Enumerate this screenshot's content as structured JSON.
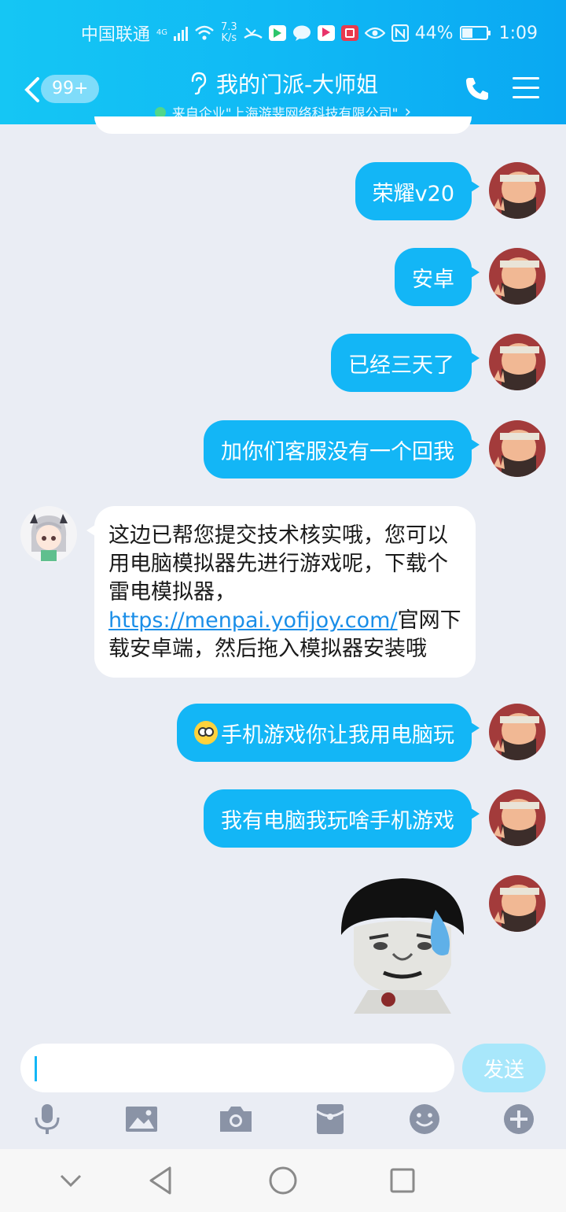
{
  "status_bar": {
    "carrier": "中国联通",
    "network": "4G",
    "speed_value": "7.3",
    "speed_unit": "K/s",
    "battery_percent": "44%",
    "battery_level": 0.44,
    "time": "1:09"
  },
  "header": {
    "unread_badge": "99+",
    "title": "我的门派-大师姐",
    "subtitle": "来自企业\"上海游斐网络科技有限公司\"",
    "subtitle_chevron": "›"
  },
  "messages": [
    {
      "sender": "me",
      "text": "荣耀v20"
    },
    {
      "sender": "me",
      "text": "安卓"
    },
    {
      "sender": "me",
      "text": "已经三天了"
    },
    {
      "sender": "me",
      "text": "加你们客服没有一个回我"
    },
    {
      "sender": "cs",
      "text_before": "这边已帮您提交技术核实哦，您可以用电脑模拟器先进行游戏呢，下载个雷电模拟器，",
      "link": "https://menpai.yofijoy.com/",
      "text_after": "官网下载安卓端，然后拖入模拟器安装哦"
    },
    {
      "sender": "me",
      "text": "手机游戏你让我用电脑玩",
      "emoji": "flushed-face"
    },
    {
      "sender": "me",
      "text": "我有电脑我玩啥手机游戏"
    },
    {
      "sender": "me",
      "sticker": "sweating-meme-face"
    }
  ],
  "input": {
    "value": "",
    "send_label": "发送"
  },
  "toolbar_icons": [
    "microphone-icon",
    "image-icon",
    "camera-icon",
    "red-envelope-icon",
    "emoji-icon",
    "plus-icon"
  ],
  "navbar_icons": [
    "chevron-down-icon",
    "back-triangle-icon",
    "home-circle-icon",
    "recents-square-icon"
  ],
  "colors": {
    "header_blue": "#10b9f5",
    "bubble_blue": "#13b6f6",
    "chat_bg": "#eaedf4",
    "link_blue": "#1a8ee8",
    "online_green": "#52d68a"
  }
}
